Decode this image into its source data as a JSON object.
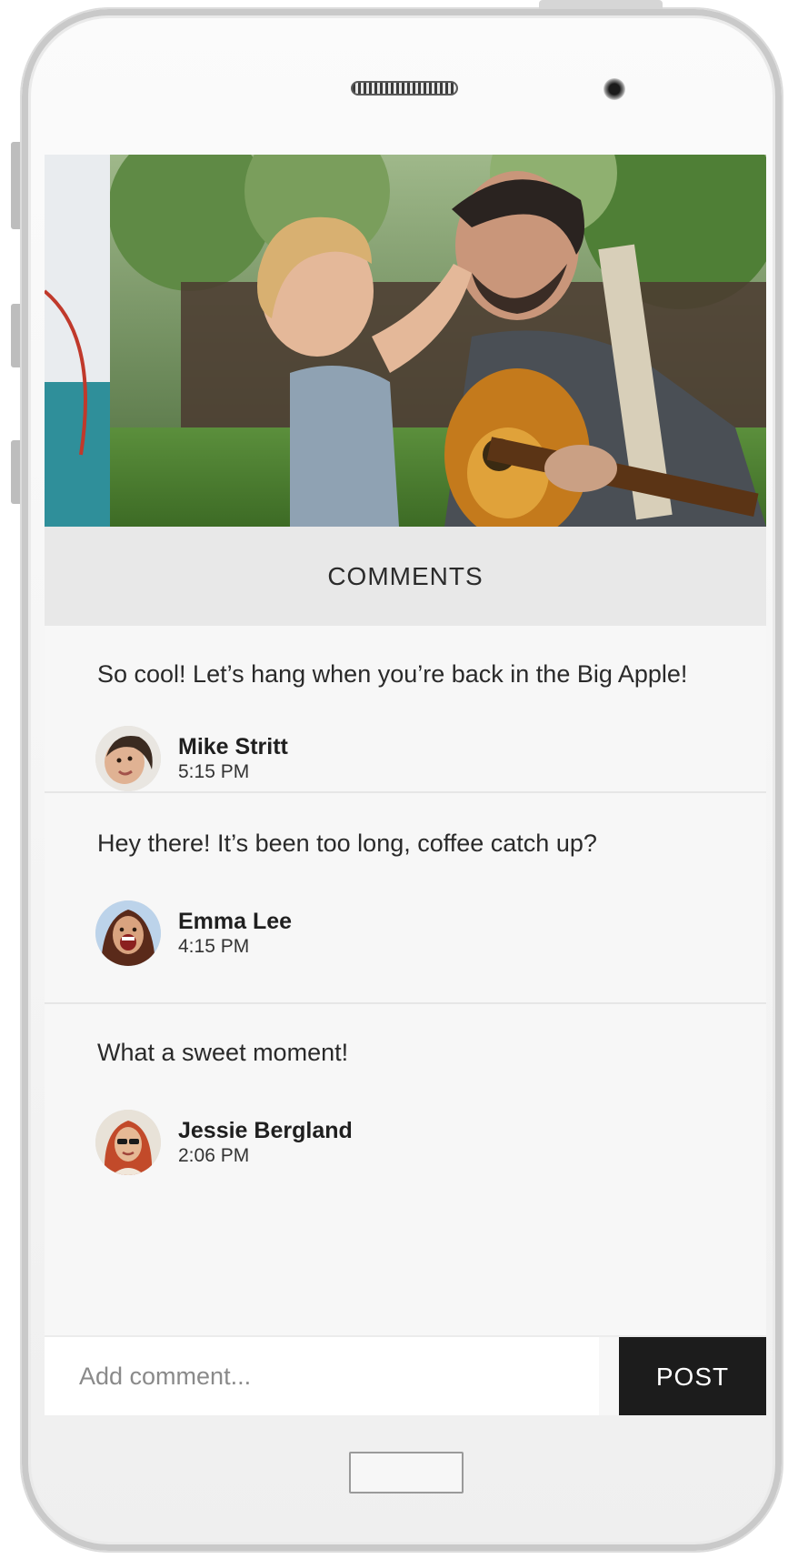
{
  "header": {
    "title": "COMMENTS"
  },
  "hero": {
    "description_icon": "photo"
  },
  "comments": [
    {
      "text": "So cool! Let’s hang when you’re back in the Big Apple!",
      "author": "Mike Stritt",
      "time": "5:15 PM"
    },
    {
      "text": "Hey there! It’s been too long, coffee catch up?",
      "author": "Emma Lee",
      "time": "4:15 PM"
    },
    {
      "text": "What a sweet moment!",
      "author": "Jessie Bergland",
      "time": "2:06 PM"
    }
  ],
  "composer": {
    "placeholder": "Add comment...",
    "post_label": "POST"
  },
  "colors": {
    "post_button": "#1c1c1c",
    "header_bg": "#e8e8e8",
    "screen_bg": "#f7f7f7"
  }
}
